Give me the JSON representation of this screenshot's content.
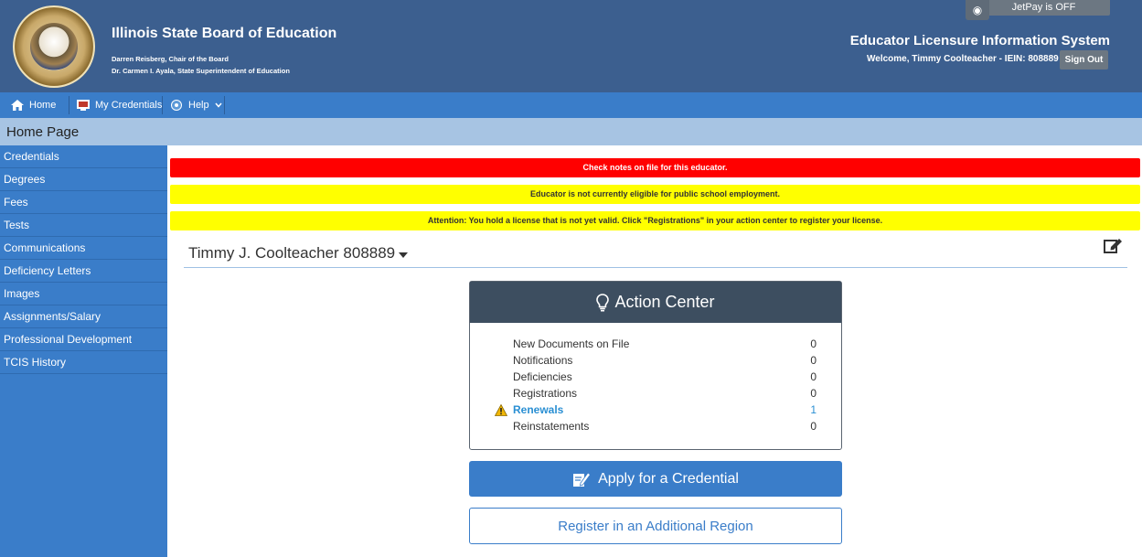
{
  "header": {
    "org_title": "Illinois State Board of Education",
    "chair": "Darren Reisberg, Chair of the Board",
    "superintendent": "Dr. Carmen I. Ayala, State Superintendent of Education",
    "system_title": "Educator Licensure Information System",
    "welcome": "Welcome, Timmy Coolteacher - IEIN: 808889",
    "signout_label": "Sign Out",
    "jetpay_label": "JetPay is OFF",
    "gear_icon": "settings-icon"
  },
  "nav": {
    "home": "Home",
    "credentials": "My Credentials",
    "help": "Help"
  },
  "page_title": "Home Page",
  "sidebar": {
    "items": [
      {
        "label": "Credentials"
      },
      {
        "label": "Degrees"
      },
      {
        "label": "Fees"
      },
      {
        "label": "Tests"
      },
      {
        "label": "Communications"
      },
      {
        "label": "Deficiency Letters"
      },
      {
        "label": "Images"
      },
      {
        "label": "Assignments/Salary"
      },
      {
        "label": "Professional Development"
      },
      {
        "label": "TCIS History"
      }
    ]
  },
  "alerts": {
    "notes": "Check notes on file for this educator.",
    "eligibility": "Educator is not currently eligible for public school employment.",
    "attention": "Attention: You hold a license that is not yet valid. Click \"Registrations\" in your action center to register your license."
  },
  "educator": {
    "name": "Timmy J. Coolteacher 808889"
  },
  "action_center": {
    "title": "Action Center",
    "rows": [
      {
        "label": "New Documents on File",
        "count": "0"
      },
      {
        "label": "Notifications",
        "count": "0"
      },
      {
        "label": "Deficiencies",
        "count": "0"
      },
      {
        "label": "Registrations",
        "count": "0"
      },
      {
        "label": "Renewals",
        "count": "1"
      },
      {
        "label": "Reinstatements",
        "count": "0"
      }
    ]
  },
  "buttons": {
    "apply": "Apply for a Credential",
    "register": "Register in an Additional Region"
  },
  "colors": {
    "header_bg": "#3c5f8f",
    "nav_bg": "#3a7dc9",
    "alert_red": "#ff0000",
    "alert_yellow": "#ffff00",
    "action_header": "#3d4e60"
  }
}
